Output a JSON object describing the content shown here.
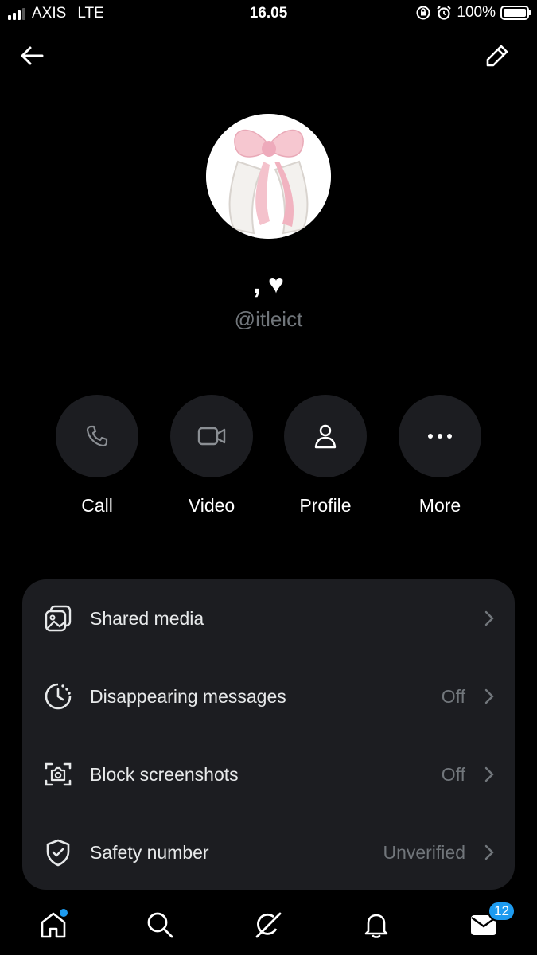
{
  "status_bar": {
    "carrier": "AXIS",
    "network": "LTE",
    "time": "16.05",
    "battery": "100%"
  },
  "header": {
    "back_icon": "arrow-left-icon",
    "edit_icon": "pencil-icon"
  },
  "profile": {
    "display_name": ", ♥",
    "handle": "@itleict"
  },
  "actions": [
    {
      "label": "Call",
      "icon": "phone-icon"
    },
    {
      "label": "Video",
      "icon": "video-camera-icon"
    },
    {
      "label": "Profile",
      "icon": "person-icon"
    },
    {
      "label": "More",
      "icon": "more-dots-icon"
    }
  ],
  "settings": [
    {
      "label": "Shared media",
      "value": "",
      "icon": "image-gallery-icon"
    },
    {
      "label": "Disappearing messages",
      "value": "Off",
      "icon": "timer-icon"
    },
    {
      "label": "Block screenshots",
      "value": "Off",
      "icon": "screenshot-camera-icon"
    },
    {
      "label": "Safety number",
      "value": "Unverified",
      "icon": "shield-check-icon"
    }
  ],
  "bottom_nav": {
    "messages_badge": "12"
  },
  "colors": {
    "background": "#000000",
    "card": "#1c1d21",
    "muted_text": "#71767b",
    "accent": "#1d9bf0"
  }
}
